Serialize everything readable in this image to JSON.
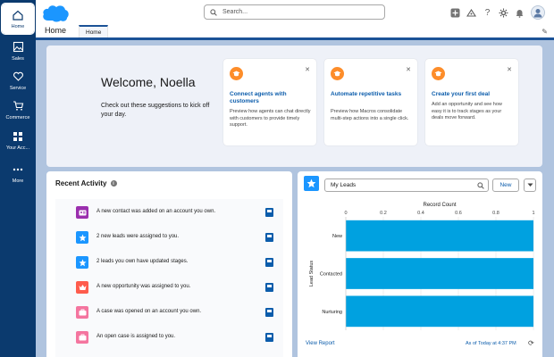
{
  "rail": {
    "items": [
      {
        "label": "Home",
        "icon": "home-icon"
      },
      {
        "label": "Sales",
        "icon": "image-icon"
      },
      {
        "label": "Service",
        "icon": "heart-icon"
      },
      {
        "label": "Commerce",
        "icon": "cart-icon"
      },
      {
        "label": "Your Acc...",
        "icon": "grid-icon"
      },
      {
        "label": "More",
        "icon": "ellipsis-icon"
      }
    ]
  },
  "header": {
    "search_placeholder": "Search..."
  },
  "appnav": {
    "app_name": "Home",
    "tab_label": "Home"
  },
  "welcome": {
    "title": "Welcome, Noella",
    "subtitle": "Check out these suggestions to kick off your day.",
    "cards": [
      {
        "title": "Connect agents with customers",
        "description": "Preview how agents can chat directly with customers to provide timely support."
      },
      {
        "title": "Automate repetitive tasks",
        "description": "Preview how Macros consolidate multi-step actions into a single click."
      },
      {
        "title": "Create your first deal",
        "description": "Add an opportunity and see how easy it is to track stages as your deals move forward."
      }
    ]
  },
  "activity": {
    "title": "Recent Activity",
    "items": [
      {
        "text": "A new contact was added on an account you own.",
        "icon": "contact-icon",
        "color": "#9b2fae"
      },
      {
        "text": "2 new leads were assigned to you.",
        "icon": "lead-star-icon",
        "color": "#1b96ff"
      },
      {
        "text": "2 leads you own have updated stages.",
        "icon": "lead-star-icon",
        "color": "#1b96ff"
      },
      {
        "text": "A new opportunity was assigned to you.",
        "icon": "crown-icon",
        "color": "#fe5c4c"
      },
      {
        "text": "A case was opened on an account you own.",
        "icon": "briefcase-icon",
        "color": "#f4759f"
      },
      {
        "text": "An open case is assigned to you.",
        "icon": "briefcase-icon",
        "color": "#f4759f"
      }
    ]
  },
  "leads": {
    "list_name": "My Leads",
    "new_label": "New",
    "view_report": "View Report",
    "as_of": "As of Today at 4:37 PM",
    "accent": "#1b96ff"
  },
  "chart_data": {
    "type": "bar",
    "orientation": "horizontal",
    "categories": [
      "New",
      "Contacted",
      "Nurturing"
    ],
    "values": [
      1,
      1,
      1
    ],
    "xlabel": "Record Count",
    "ylabel": "Lead Status",
    "xlim": [
      0,
      1
    ],
    "x_ticks": [
      "0",
      "0.2",
      "0.4",
      "0.6",
      "0.8",
      "1"
    ],
    "grid": true,
    "color": "#00a1e0"
  }
}
